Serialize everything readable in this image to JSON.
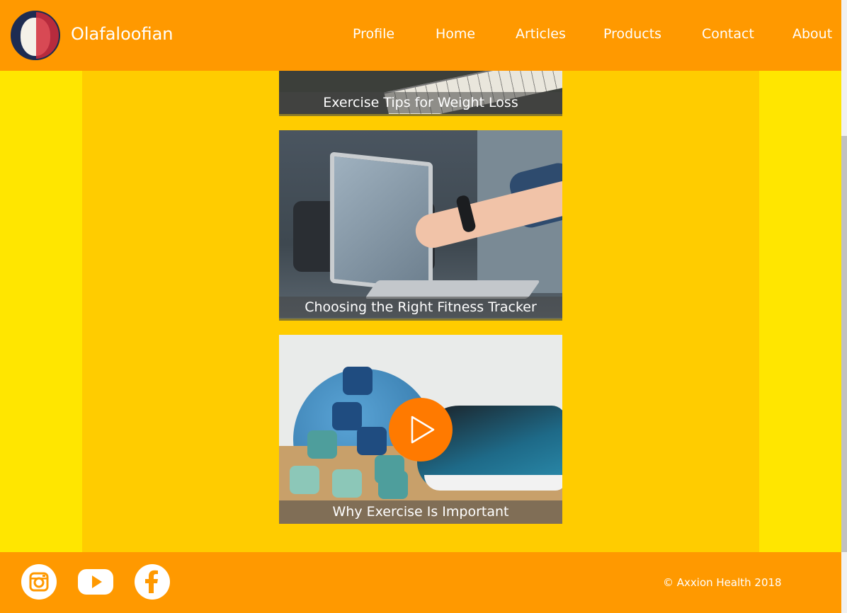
{
  "site": {
    "brand": "Olafaloofian"
  },
  "nav": {
    "items": [
      "Profile",
      "Home",
      "Articles",
      "Products",
      "Contact",
      "About"
    ]
  },
  "articles": [
    {
      "title": "Exercise Tips for Weight Loss"
    },
    {
      "title": "Choosing the Right Fitness Tracker"
    },
    {
      "title": "Why Exercise Is Important"
    }
  ],
  "footer": {
    "social_icons": [
      "instagram-icon",
      "youtube-icon",
      "facebook-icon"
    ],
    "copyright": "© Axxion Health 2018"
  },
  "colors": {
    "header": "#ff9900",
    "content": "#ffcc00",
    "side": "#ffe600",
    "play_button": "#ff7a00"
  }
}
